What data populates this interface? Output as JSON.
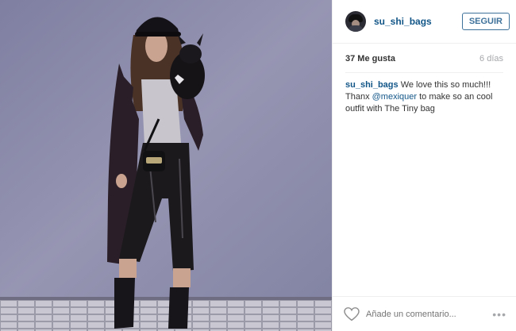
{
  "post": {
    "username": "su_shi_bags",
    "follow_label": "SEGUIR",
    "likes": "37 Me gusta",
    "age": "6 días"
  },
  "caption": {
    "username": "su_shi_bags",
    "text_before_mention": " We love this so much!!! Thanx ",
    "mention": "@mexiquer",
    "text_after_mention": " to make so an cool outfit with The Tiny bag"
  },
  "comment_box": {
    "placeholder": "Añade un comentario..."
  },
  "more_label": "•••",
  "colors": {
    "link": "#125688",
    "follow_border": "#3f729b",
    "muted": "#a5a7aa",
    "wall": "#8c8aa8"
  }
}
